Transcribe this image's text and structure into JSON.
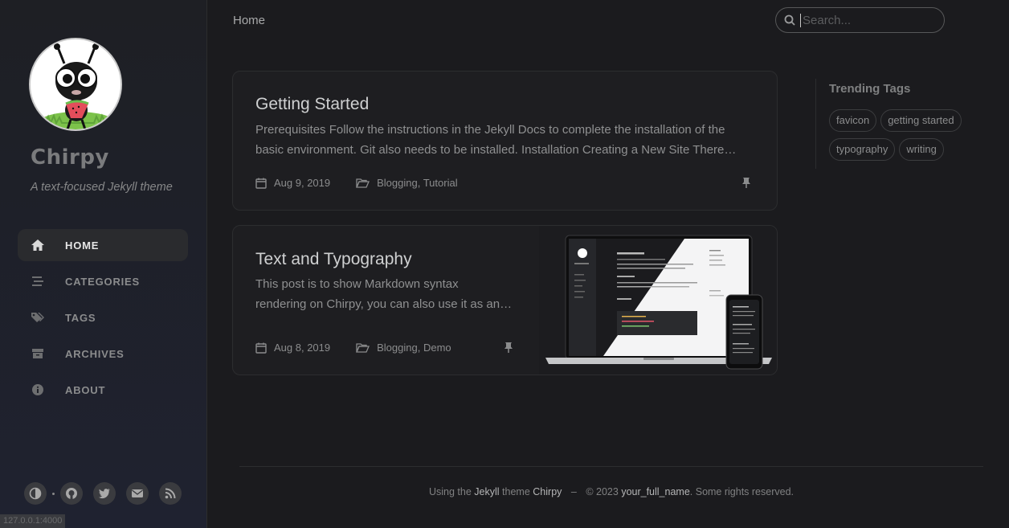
{
  "sidebar": {
    "site_title": "Chirpy",
    "site_subtitle": "A text-focused Jekyll theme",
    "nav": [
      {
        "label": "HOME",
        "icon": "home-icon",
        "active": true
      },
      {
        "label": "CATEGORIES",
        "icon": "stream-icon",
        "active": false
      },
      {
        "label": "TAGS",
        "icon": "tags-icon",
        "active": false
      },
      {
        "label": "ARCHIVES",
        "icon": "archive-icon",
        "active": false
      },
      {
        "label": "ABOUT",
        "icon": "info-icon",
        "active": false
      }
    ],
    "bottom_icons": [
      "theme-toggle-icon",
      "github-icon",
      "twitter-icon",
      "email-icon",
      "rss-icon"
    ]
  },
  "status_bar": {
    "url": "127.0.0.1:4000"
  },
  "topbar": {
    "breadcrumb": "Home",
    "search_placeholder": "Search..."
  },
  "posts": [
    {
      "title": "Getting Started",
      "excerpt_line1": "Prerequisites Follow the instructions in the Jekyll Docs to complete the installation of the",
      "excerpt_line2": "basic environment. Git also needs to be installed. Installation Creating a New Site There…",
      "date": "Aug 9, 2019",
      "categories": "Blogging, Tutorial",
      "pinned": true
    },
    {
      "title": "Text and Typography",
      "excerpt_line1": "This post is to show Markdown syntax",
      "excerpt_line2": "rendering on Chirpy, you can also use it as an…",
      "date": "Aug 8, 2019",
      "categories": "Blogging, Demo",
      "pinned": true
    }
  ],
  "panel": {
    "title": "Trending Tags",
    "tags": [
      "favicon",
      "getting started",
      "typography",
      "writing"
    ]
  },
  "footer": {
    "using": "Using the",
    "jekyll": "Jekyll",
    "theme": "theme",
    "chirpy": "Chirpy",
    "dash": "–",
    "copy": "© 2023",
    "name": "your_full_name",
    "rights": ". Some rights reserved."
  },
  "colors": {
    "background": "#1b1b1e",
    "sidebar": "#1e1f24",
    "card": "#1e1e21",
    "accent_text": "#cfd0d1"
  }
}
